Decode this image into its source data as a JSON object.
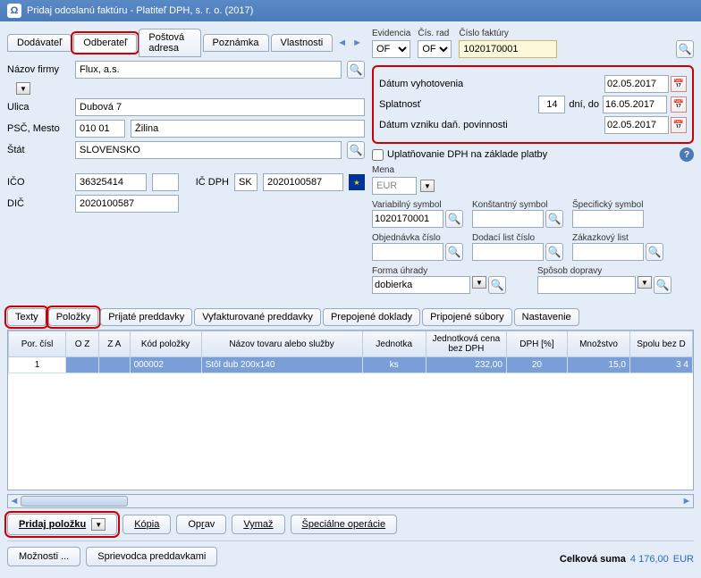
{
  "window": {
    "title": "Pridaj odoslanú faktúru - Platiteľ DPH, s. r. o. (2017)"
  },
  "supplier_tabs": {
    "items": [
      "Dodávateľ",
      "Odberateľ",
      "Poštová adresa",
      "Poznámka",
      "Vlastnosti"
    ],
    "active": 1
  },
  "company": {
    "name_label": "Názov firmy",
    "name": "Flux, a.s.",
    "street_label": "Ulica",
    "street": "Dubová 7",
    "city_label": "PSČ, Mesto",
    "psc": "010 01",
    "city": "Žilina",
    "state_label": "Štát",
    "state": "SLOVENSKO",
    "ico_label": "IČO",
    "ico": "36325414",
    "icdph_label": "IČ DPH",
    "icdph_prefix": "SK",
    "icdph": "2020100587",
    "dic_label": "DIČ",
    "dic": "2020100587"
  },
  "evidence": {
    "ev_label": "Evidencia",
    "ev": "OF",
    "cr_label": "Čís. rad",
    "cr": "OF",
    "num_label": "Číslo faktúry",
    "num": "1020170001"
  },
  "dates": {
    "issue_label": "Dátum vyhotovenia",
    "issue": "02.05.2017",
    "due_label": "Splatnosť",
    "days": "14",
    "days_suffix": "dní, do",
    "due": "16.05.2017",
    "tax_label": "Dátum vzniku daň. povinnosti",
    "tax": "02.05.2017"
  },
  "vat_checkbox": "Uplatňovanie DPH na základe platby",
  "currency": {
    "label": "Mena",
    "value": "EUR"
  },
  "symbols": {
    "var_label": "Variabilný symbol",
    "var": "1020170001",
    "kon_label": "Konštantný symbol",
    "kon": "",
    "spec_label": "Špecifický symbol",
    "spec": ""
  },
  "refs": {
    "obj_label": "Objednávka číslo",
    "obj": "",
    "dod_label": "Dodací list číslo",
    "dod": "",
    "zak_label": "Zákazkový list",
    "zak": ""
  },
  "payment": {
    "forma_label": "Forma úhrady",
    "forma": "dobierka",
    "doprava_label": "Spôsob dopravy",
    "doprava": ""
  },
  "mid_tabs": [
    "Texty",
    "Položky",
    "Prijaté preddavky",
    "Vyfakturované preddavky",
    "Prepojené doklady",
    "Pripojené súbory",
    "Nastavenie"
  ],
  "grid": {
    "headers": [
      "Por. čísl",
      "O Z",
      "Z A",
      "Kód položky",
      "Názov tovaru alebo služby",
      "Jednotka",
      "Jednotková cena bez DPH",
      "DPH [%]",
      "Množstvo",
      "Spolu bez D"
    ],
    "rows": [
      {
        "por": "1",
        "oz": "",
        "za": "",
        "kod": "000002",
        "nazov": "Stôl dub 200x140",
        "jed": "ks",
        "cena": "232,00",
        "dph": "20",
        "mn": "15,0",
        "spolu": "3 4"
      }
    ]
  },
  "item_btns": {
    "add": "Pridaj položku",
    "copy": "Kópia",
    "edit": "Oprav",
    "del": "Vymaž",
    "special": "Špeciálne operácie"
  },
  "bottom_btns": {
    "opts": "Možnosti ...",
    "wizard": "Sprievodca preddavkami"
  },
  "total": {
    "label": "Celková suma",
    "amount": "4 176,00",
    "cur": "EUR"
  }
}
